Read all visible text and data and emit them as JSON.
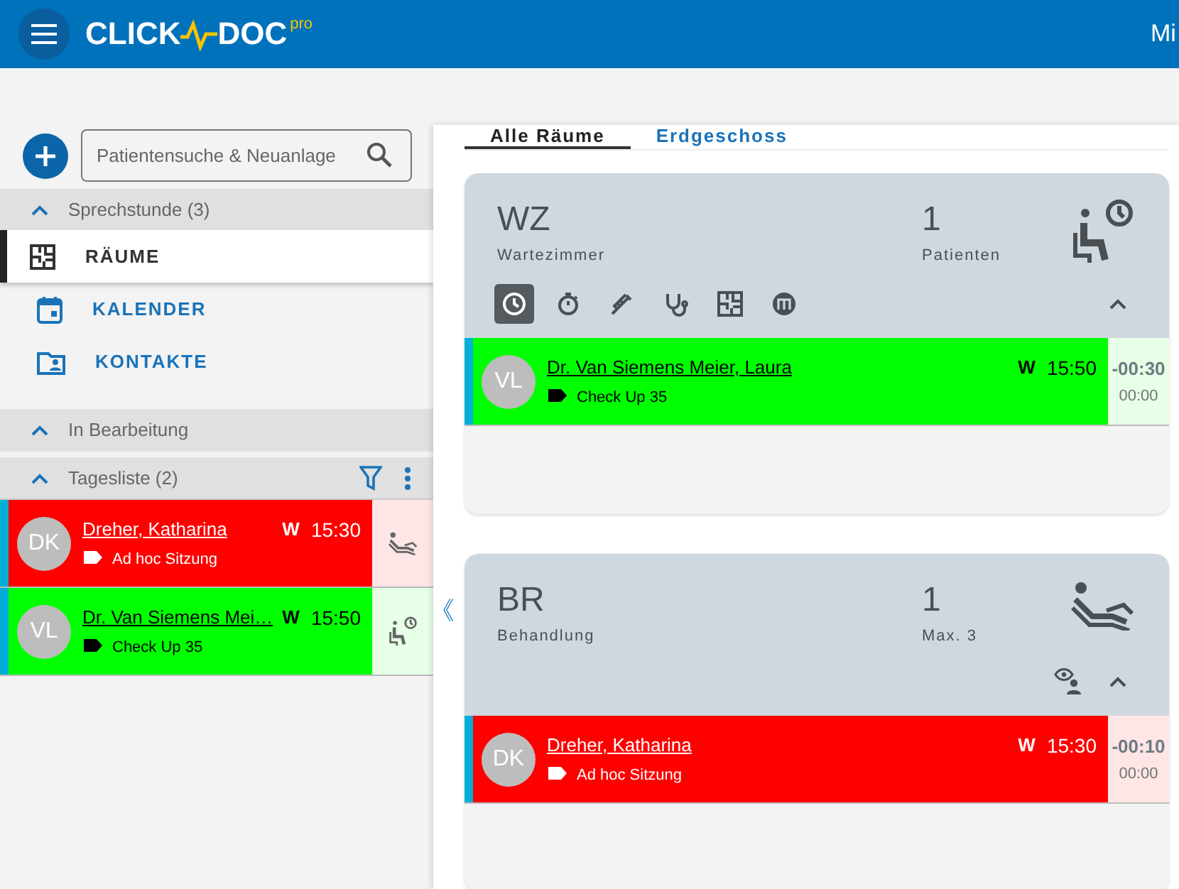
{
  "header": {
    "logo_left": "CLICK",
    "logo_right": "DOC",
    "logo_badge": "pro",
    "user": "Mi"
  },
  "sidebar": {
    "search": {
      "placeholder": "Patientensuche & Neuanlage"
    },
    "sections": [
      {
        "title": "Sprechstunde (3)",
        "expanded": true,
        "kind": "nav",
        "items": [
          {
            "label": "RÄUME",
            "kind": "floorplan",
            "selected": true
          },
          {
            "label": "KALENDER",
            "kind": "calendar",
            "selected": false
          },
          {
            "label": "KONTAKTE",
            "kind": "contacts",
            "selected": false
          }
        ]
      },
      {
        "title": "In Bearbeitung",
        "expanded": true,
        "kind": "plain"
      },
      {
        "title": "Tagesliste (2)",
        "expanded": true,
        "kind": "patients",
        "patients": [
          {
            "initials": "DK",
            "name": "Dreher, Katharina",
            "tag": "Ad hoc Sitzung",
            "flag": "W",
            "time": "15:30",
            "color": "#ff0000",
            "dark_text": false,
            "kind": "treatment"
          },
          {
            "initials": "VL",
            "name": "Dr. Van Siemens Mei…",
            "tag": "Check Up 35",
            "flag": "W",
            "time": "15:50",
            "color": "#00ff00",
            "dark_text": true,
            "kind": "waiting"
          }
        ]
      }
    ]
  },
  "collapse_toggle": "《",
  "tabs": [
    {
      "label": "Alle Räume",
      "selected": true
    },
    {
      "label": "Erdgeschoss",
      "selected": false
    }
  ],
  "rooms": [
    {
      "code": "WZ",
      "name": "Wartezimmer",
      "count": "1",
      "count_label": "Patienten",
      "kind": "waiting",
      "expanded": true,
      "filters": [
        {
          "kind": "clock",
          "selected": true
        },
        {
          "kind": "timer",
          "selected": false
        },
        {
          "kind": "syringe",
          "selected": false
        },
        {
          "kind": "stethoscope",
          "selected": false
        },
        {
          "kind": "floorplan",
          "selected": false
        },
        {
          "kind": "m-badge",
          "selected": false
        }
      ],
      "patients": [
        {
          "initials": "VL",
          "name": "Dr. Van Siemens Meier, Laura",
          "tag": "Check Up 35",
          "flag": "W",
          "time": "15:50",
          "delta": "-00:30",
          "duration": "00:00",
          "color": "#00ff00",
          "dark_text": true
        }
      ]
    },
    {
      "code": "BR",
      "name": "Behandlung",
      "count": "1",
      "count_label": "Max. 3",
      "kind": "treatment",
      "expanded": true,
      "watch": true,
      "patients": [
        {
          "initials": "DK",
          "name": "Dreher, Katharina",
          "tag": "Ad hoc Sitzung",
          "flag": "W",
          "time": "15:30",
          "delta": "-00:10",
          "duration": "00:00",
          "color": "#ff0000",
          "dark_text": false
        }
      ]
    }
  ]
}
